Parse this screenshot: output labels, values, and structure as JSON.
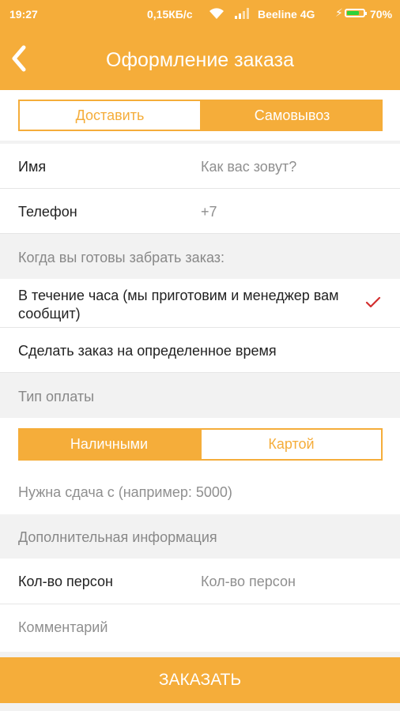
{
  "status_bar": {
    "time": "19:27",
    "speed": "0,15КБ/с",
    "carrier": "Beeline 4G",
    "battery": "70%",
    "battery_level": 0.7
  },
  "header": {
    "title": "Оформление заказа",
    "back_icon": "chevron-left-icon"
  },
  "delivery_toggle": {
    "options": [
      "Доставить",
      "Самовывоз"
    ],
    "selected": "Самовывоз"
  },
  "form": {
    "name": {
      "label": "Имя",
      "placeholder": "Как вас зовут?"
    },
    "phone": {
      "label": "Телефон",
      "value": "+7"
    }
  },
  "pickup_time": {
    "header": "Когда вы готовы забрать заказ:",
    "option1": "В течение часа (мы приготовим и менеджер вам сообщит)",
    "option2": "Сделать заказ на определенное время",
    "selected": "option1"
  },
  "payment": {
    "header": "Тип оплаты",
    "options": [
      "Наличными",
      "Картой"
    ],
    "selected": "Наличными",
    "change_placeholder": "Нужна сдача с (например: 5000)"
  },
  "additional": {
    "header": "Дополнительная информация",
    "persons_label": "Кол-во персон",
    "persons_placeholder": "Кол-во персон",
    "comment_placeholder": "Комментарий"
  },
  "order_button": "ЗАКАЗАТЬ",
  "colors": {
    "accent": "#f5ad3a",
    "check": "#d32f2f",
    "battery": "#2fd33a"
  }
}
